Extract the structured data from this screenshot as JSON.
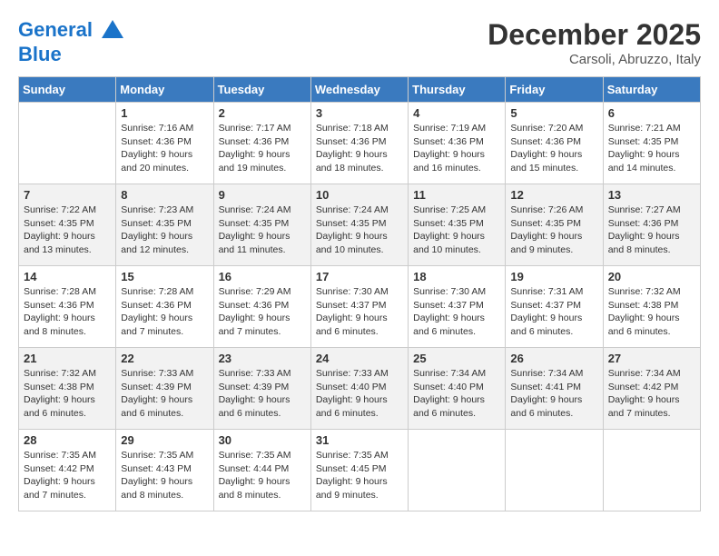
{
  "header": {
    "logo_line1": "General",
    "logo_line2": "Blue",
    "month": "December 2025",
    "location": "Carsoli, Abruzzo, Italy"
  },
  "days_of_week": [
    "Sunday",
    "Monday",
    "Tuesday",
    "Wednesday",
    "Thursday",
    "Friday",
    "Saturday"
  ],
  "weeks": [
    [
      {
        "num": "",
        "info": ""
      },
      {
        "num": "1",
        "info": "Sunrise: 7:16 AM\nSunset: 4:36 PM\nDaylight: 9 hours\nand 20 minutes."
      },
      {
        "num": "2",
        "info": "Sunrise: 7:17 AM\nSunset: 4:36 PM\nDaylight: 9 hours\nand 19 minutes."
      },
      {
        "num": "3",
        "info": "Sunrise: 7:18 AM\nSunset: 4:36 PM\nDaylight: 9 hours\nand 18 minutes."
      },
      {
        "num": "4",
        "info": "Sunrise: 7:19 AM\nSunset: 4:36 PM\nDaylight: 9 hours\nand 16 minutes."
      },
      {
        "num": "5",
        "info": "Sunrise: 7:20 AM\nSunset: 4:36 PM\nDaylight: 9 hours\nand 15 minutes."
      },
      {
        "num": "6",
        "info": "Sunrise: 7:21 AM\nSunset: 4:35 PM\nDaylight: 9 hours\nand 14 minutes."
      }
    ],
    [
      {
        "num": "7",
        "info": "Sunrise: 7:22 AM\nSunset: 4:35 PM\nDaylight: 9 hours\nand 13 minutes."
      },
      {
        "num": "8",
        "info": "Sunrise: 7:23 AM\nSunset: 4:35 PM\nDaylight: 9 hours\nand 12 minutes."
      },
      {
        "num": "9",
        "info": "Sunrise: 7:24 AM\nSunset: 4:35 PM\nDaylight: 9 hours\nand 11 minutes."
      },
      {
        "num": "10",
        "info": "Sunrise: 7:24 AM\nSunset: 4:35 PM\nDaylight: 9 hours\nand 10 minutes."
      },
      {
        "num": "11",
        "info": "Sunrise: 7:25 AM\nSunset: 4:35 PM\nDaylight: 9 hours\nand 10 minutes."
      },
      {
        "num": "12",
        "info": "Sunrise: 7:26 AM\nSunset: 4:35 PM\nDaylight: 9 hours\nand 9 minutes."
      },
      {
        "num": "13",
        "info": "Sunrise: 7:27 AM\nSunset: 4:36 PM\nDaylight: 9 hours\nand 8 minutes."
      }
    ],
    [
      {
        "num": "14",
        "info": "Sunrise: 7:28 AM\nSunset: 4:36 PM\nDaylight: 9 hours\nand 8 minutes."
      },
      {
        "num": "15",
        "info": "Sunrise: 7:28 AM\nSunset: 4:36 PM\nDaylight: 9 hours\nand 7 minutes."
      },
      {
        "num": "16",
        "info": "Sunrise: 7:29 AM\nSunset: 4:36 PM\nDaylight: 9 hours\nand 7 minutes."
      },
      {
        "num": "17",
        "info": "Sunrise: 7:30 AM\nSunset: 4:37 PM\nDaylight: 9 hours\nand 6 minutes."
      },
      {
        "num": "18",
        "info": "Sunrise: 7:30 AM\nSunset: 4:37 PM\nDaylight: 9 hours\nand 6 minutes."
      },
      {
        "num": "19",
        "info": "Sunrise: 7:31 AM\nSunset: 4:37 PM\nDaylight: 9 hours\nand 6 minutes."
      },
      {
        "num": "20",
        "info": "Sunrise: 7:32 AM\nSunset: 4:38 PM\nDaylight: 9 hours\nand 6 minutes."
      }
    ],
    [
      {
        "num": "21",
        "info": "Sunrise: 7:32 AM\nSunset: 4:38 PM\nDaylight: 9 hours\nand 6 minutes."
      },
      {
        "num": "22",
        "info": "Sunrise: 7:33 AM\nSunset: 4:39 PM\nDaylight: 9 hours\nand 6 minutes."
      },
      {
        "num": "23",
        "info": "Sunrise: 7:33 AM\nSunset: 4:39 PM\nDaylight: 9 hours\nand 6 minutes."
      },
      {
        "num": "24",
        "info": "Sunrise: 7:33 AM\nSunset: 4:40 PM\nDaylight: 9 hours\nand 6 minutes."
      },
      {
        "num": "25",
        "info": "Sunrise: 7:34 AM\nSunset: 4:40 PM\nDaylight: 9 hours\nand 6 minutes."
      },
      {
        "num": "26",
        "info": "Sunrise: 7:34 AM\nSunset: 4:41 PM\nDaylight: 9 hours\nand 6 minutes."
      },
      {
        "num": "27",
        "info": "Sunrise: 7:34 AM\nSunset: 4:42 PM\nDaylight: 9 hours\nand 7 minutes."
      }
    ],
    [
      {
        "num": "28",
        "info": "Sunrise: 7:35 AM\nSunset: 4:42 PM\nDaylight: 9 hours\nand 7 minutes."
      },
      {
        "num": "29",
        "info": "Sunrise: 7:35 AM\nSunset: 4:43 PM\nDaylight: 9 hours\nand 8 minutes."
      },
      {
        "num": "30",
        "info": "Sunrise: 7:35 AM\nSunset: 4:44 PM\nDaylight: 9 hours\nand 8 minutes."
      },
      {
        "num": "31",
        "info": "Sunrise: 7:35 AM\nSunset: 4:45 PM\nDaylight: 9 hours\nand 9 minutes."
      },
      {
        "num": "",
        "info": ""
      },
      {
        "num": "",
        "info": ""
      },
      {
        "num": "",
        "info": ""
      }
    ]
  ]
}
